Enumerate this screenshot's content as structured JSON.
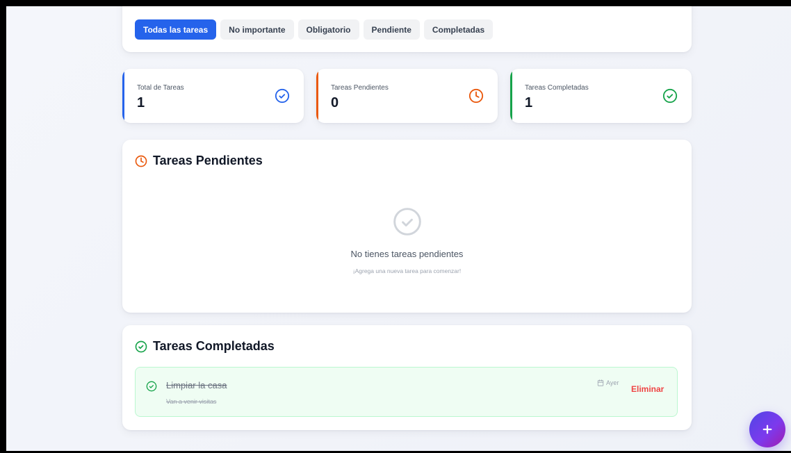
{
  "filters": {
    "items": [
      {
        "label": "Todas las tareas",
        "active": true
      },
      {
        "label": "No importante",
        "active": false
      },
      {
        "label": "Obligatorio",
        "active": false
      },
      {
        "label": "Pendiente",
        "active": false
      },
      {
        "label": "Completadas",
        "active": false
      }
    ]
  },
  "stats": {
    "total": {
      "label": "Total de Tareas",
      "value": "1",
      "icon": "check-circle-icon",
      "color": "#2563eb"
    },
    "pending": {
      "label": "Tareas Pendientes",
      "value": "0",
      "icon": "clock-icon",
      "color": "#ea580c"
    },
    "completed": {
      "label": "Tareas Completadas",
      "value": "1",
      "icon": "check-circle-icon",
      "color": "#16a34a"
    }
  },
  "pending_section": {
    "title": "Tareas Pendientes",
    "empty_title": "No tienes tareas pendientes",
    "empty_subtitle": "¡Agrega una nueva tarea para comenzar!"
  },
  "completed_section": {
    "title": "Tareas Completadas",
    "tasks": [
      {
        "title": "Limpiar la casa",
        "description": "Van a venir visitas",
        "date": "Ayer",
        "delete_label": "Eliminar"
      }
    ]
  },
  "fab": {
    "icon": "plus-icon"
  },
  "colors": {
    "accent": "#2563eb",
    "pending": "#ea580c",
    "done": "#16a34a",
    "danger": "#ef4444"
  }
}
